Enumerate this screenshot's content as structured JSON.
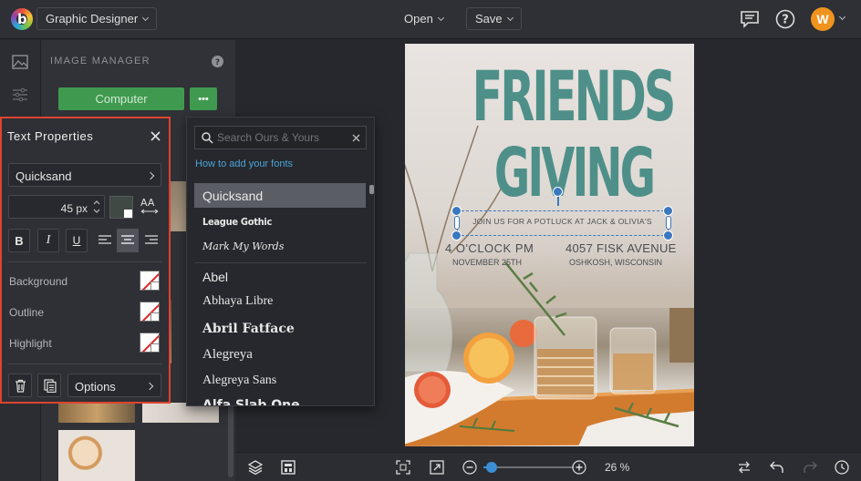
{
  "topbar": {
    "logo_letter": "b",
    "mode_label": "Graphic Designer",
    "open_label": "Open",
    "save_label": "Save",
    "avatar_initial": "W",
    "avatar_color": "#f0931e"
  },
  "image_manager": {
    "title": "IMAGE MANAGER",
    "computer_button": "Computer",
    "more_button": "•••",
    "accent": "#3f9a4f"
  },
  "text_properties": {
    "title": "Text Properties",
    "font": "Quicksand",
    "size": "45 px",
    "size_icon": "AA",
    "style_buttons": [
      "B",
      "I",
      "U"
    ],
    "background_label": "Background",
    "outline_label": "Outline",
    "highlight_label": "Highlight",
    "options_label": "Options",
    "border_color": "#e0432f"
  },
  "font_dropdown": {
    "search_placeholder": "Search Ours & Yours",
    "help_link": "How to add your fonts",
    "selected": "Quicksand",
    "recent": [
      "League Gothic",
      "Mark My Words"
    ],
    "fonts": [
      "Abel",
      "Abhaya Libre",
      "Abril Fatface",
      "Alegreya",
      "Alegreya Sans",
      "Alfa Slab One"
    ]
  },
  "poster": {
    "title_line1": "FRIENDS",
    "title_line2": "GIVING",
    "subtitle": "JOIN US FOR A POTLUCK AT JACK & OLIVIA'S",
    "time": "4 O'CLOCK PM",
    "date": "NOVEMBER 25TH",
    "address": "4057 FISK AVENUE",
    "city": "OSHKOSH, WISCONSIN",
    "title_color": "#4e9089"
  },
  "bottombar": {
    "zoom": "26 %",
    "zoom_fraction": 0.09
  }
}
